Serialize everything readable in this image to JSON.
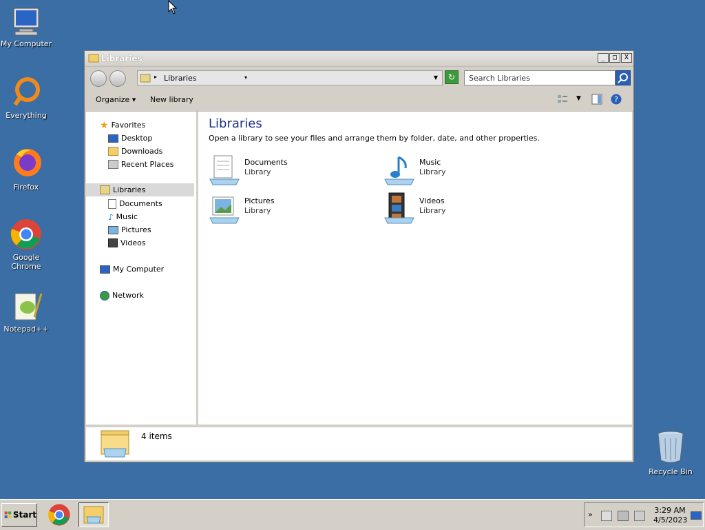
{
  "desktop": {
    "icons": [
      {
        "label": "My Computer"
      },
      {
        "label": "Everything"
      },
      {
        "label": "Firefox"
      },
      {
        "label": "Google Chrome"
      },
      {
        "label": "Notepad++"
      }
    ],
    "recycle_bin": "Recycle Bin"
  },
  "window": {
    "title": "Libraries",
    "controls": [
      "_",
      "□",
      "X"
    ],
    "address": {
      "crumb": "Libraries"
    },
    "search": {
      "placeholder": "Search Libraries"
    },
    "toolbar": {
      "organize": "Organize",
      "new_library": "New library"
    },
    "nav": {
      "favorites": "Favorites",
      "desktop": "Desktop",
      "downloads": "Downloads",
      "recent_places": "Recent Places",
      "libraries": "Libraries",
      "documents": "Documents",
      "music": "Music",
      "pictures": "Pictures",
      "videos": "Videos",
      "my_computer": "My Computer",
      "network": "Network"
    },
    "main": {
      "title": "Libraries",
      "description": "Open a library to see your files and arrange them by folder, date, and other properties.",
      "libraries": [
        {
          "name": "Documents",
          "type": "Library"
        },
        {
          "name": "Music",
          "type": "Library"
        },
        {
          "name": "Pictures",
          "type": "Library"
        },
        {
          "name": "Videos",
          "type": "Library"
        }
      ]
    },
    "details": {
      "count": "4 items"
    }
  },
  "taskbar": {
    "start": "Start",
    "time": "3:29 AM",
    "date": "4/5/2023",
    "tray_expand": "»"
  }
}
